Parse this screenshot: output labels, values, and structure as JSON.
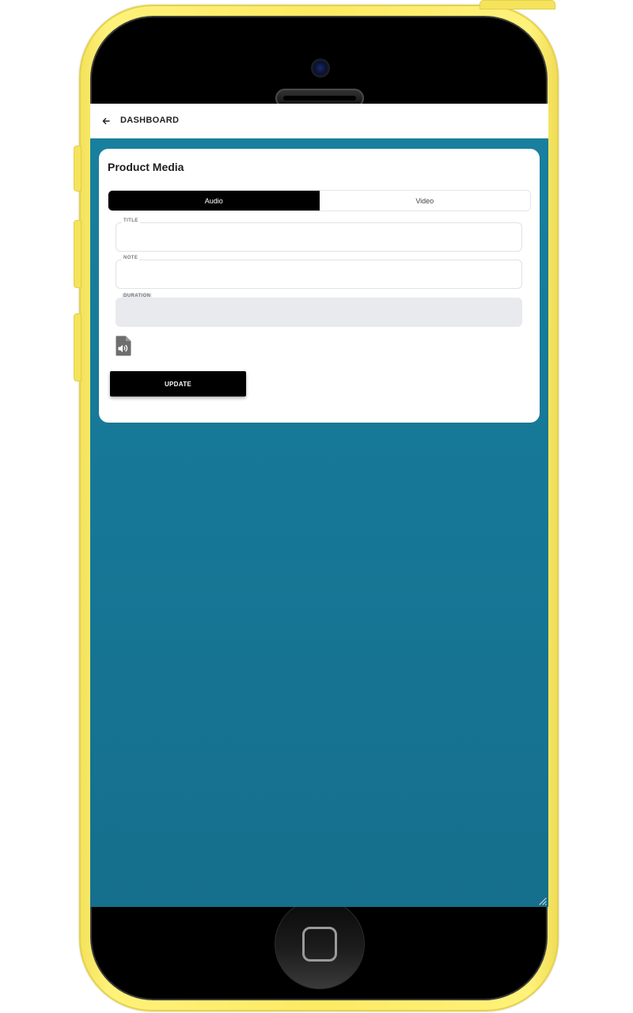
{
  "app_bar": {
    "back_icon": "arrow-left-icon",
    "title": "DASHBOARD"
  },
  "card": {
    "title": "Product Media",
    "tabs": [
      {
        "label": "Audio",
        "active": true
      },
      {
        "label": "Video",
        "active": false
      }
    ],
    "fields": {
      "title": {
        "label": "TITLE",
        "value": ""
      },
      "note": {
        "label": "NOTE",
        "value": ""
      },
      "duration": {
        "label": "DURATION",
        "value": "",
        "disabled": true
      }
    },
    "audio_icon": "audio-file-icon",
    "update_label": "UPDATE"
  },
  "colors": {
    "background_top": "#18809f",
    "background_bottom": "#156f8d",
    "accent": "#000000",
    "phone_frame": "#fbea63"
  }
}
